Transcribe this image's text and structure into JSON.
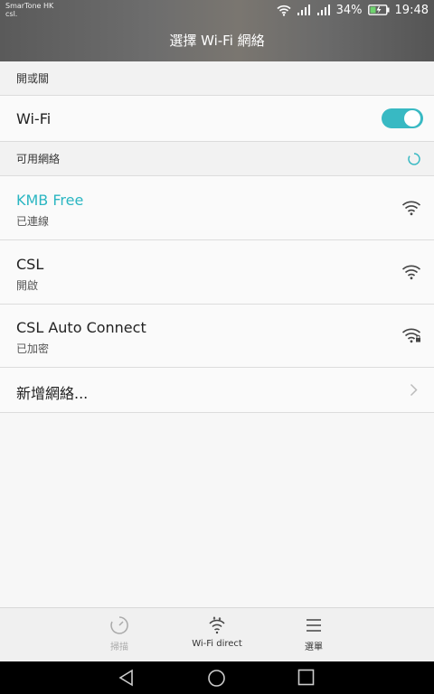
{
  "status": {
    "carrier_line1": "SmarTone HK",
    "carrier_line2": "csl.",
    "battery_percent": "34%",
    "time": "19:48"
  },
  "header": {
    "title": "選擇 Wi-Fi 網絡"
  },
  "sections": {
    "switch_header": "開或關",
    "available_header": "可用網絡"
  },
  "wifi_toggle": {
    "label": "Wi-Fi",
    "on": true
  },
  "networks": [
    {
      "name": "KMB Free",
      "status": "已連線",
      "connected": true,
      "secured": false,
      "icon": "wifi-icon"
    },
    {
      "name": "CSL",
      "status": "開啟",
      "connected": false,
      "secured": false,
      "icon": "wifi-icon"
    },
    {
      "name": "CSL Auto Connect",
      "status": "已加密",
      "connected": false,
      "secured": true,
      "icon": "wifi-lock-icon"
    }
  ],
  "add_network": {
    "label": "新增網絡..."
  },
  "toolbar": {
    "scan_label": "掃描",
    "wifi_direct_label": "Wi-Fi direct",
    "menu_label": "選單"
  },
  "colors": {
    "accent": "#38b9c3",
    "connected_text": "#2bb6c2"
  }
}
